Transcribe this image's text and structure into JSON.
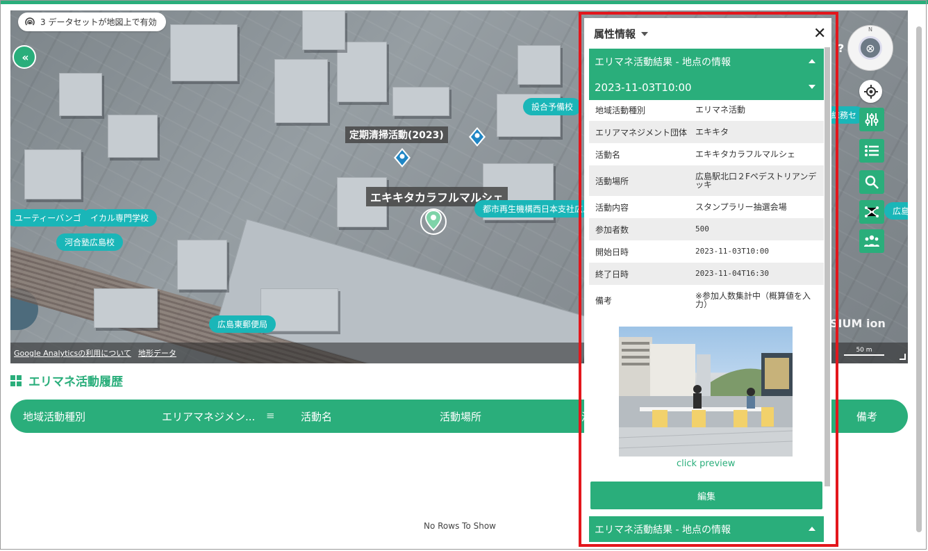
{
  "map": {
    "datasets_chip": "3 データセットが地図上で有効",
    "collapse_glyph": "‹‹",
    "help_glyph": "?",
    "compass_north": "N",
    "compass_glyph": "⊗",
    "markers": [
      "定期清掃活動(2023)",
      "エキキタカラフルマルシェ"
    ],
    "place_labels": [
      "ユーティーバンゴ",
      "イカル専門学校",
      "河合塾広島校",
      "広島東郵便局",
      "都市再生機構西日本支社広島",
      "設合予備校",
      "総務セ",
      "広島"
    ],
    "attribution": [
      "Google Analyticsの利用について",
      "地形データ"
    ],
    "engine_logo": "SIUM ion",
    "scale": "50 m"
  },
  "history": {
    "title": "エリマネ活動履歴",
    "columns": [
      "地域活動種別",
      "エリアマネジメン...",
      "活動名",
      "活動場所",
      "活",
      "備考"
    ],
    "empty_text": "No Rows To Show",
    "menu_glyph": "≡"
  },
  "panel": {
    "title": "属性情報",
    "close": "✕",
    "section_title": "エリマネ活動結果 - 地点の情報",
    "record_title": "2023-11-03T10:00",
    "rows": [
      {
        "k": "地域活動種別",
        "v": "エリマネ活動"
      },
      {
        "k": "エリアマネジメント団体",
        "v": "エキキタ"
      },
      {
        "k": "活動名",
        "v": "エキキタカラフルマルシェ"
      },
      {
        "k": "活動場所",
        "v": "広島駅北口２Fペデストリアンデッキ"
      },
      {
        "k": "活動内容",
        "v": "スタンプラリー抽選会場"
      },
      {
        "k": "参加者数",
        "v": "500"
      },
      {
        "k": "開始日時",
        "v": "2023-11-03T10:00"
      },
      {
        "k": "終了日時",
        "v": "2023-11-04T16:30"
      },
      {
        "k": "備考",
        "v": "※参加人数集計中（概算値を入力）"
      }
    ],
    "preview_link": "click preview",
    "edit_button": "編集",
    "footer_section": "エリマネ活動結果 - 地点の情報"
  },
  "colors": {
    "accent": "#2aae7b",
    "highlight": "#e3161c",
    "teal_label": "#1ab6b8"
  }
}
